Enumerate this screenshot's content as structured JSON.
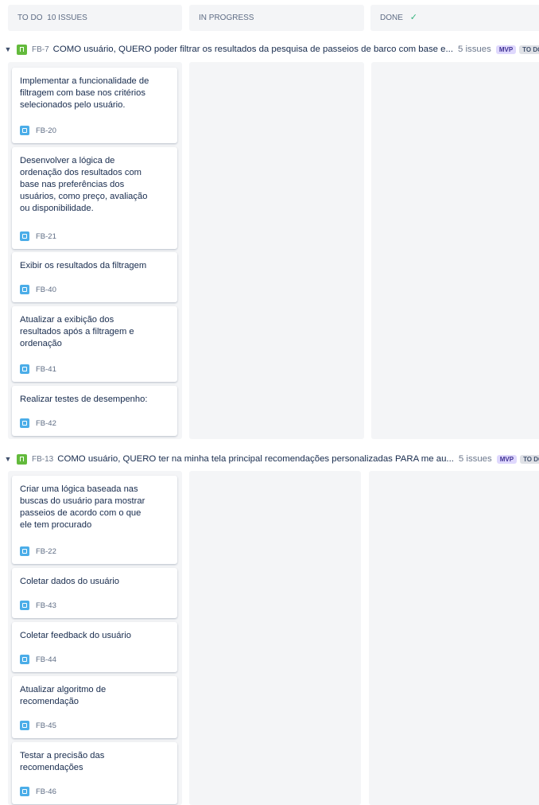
{
  "columns": [
    {
      "label": "TO DO",
      "count": "10 ISSUES"
    },
    {
      "label": "IN PROGRESS"
    },
    {
      "label": "DONE"
    }
  ],
  "swimlanes": [
    {
      "key": "FB-7",
      "summary": "COMO usuário, QUERO poder filtrar os resultados da pesquisa de passeios de barco com base e...",
      "issues": "5 issues",
      "label": "MVP",
      "status": "TO DO",
      "cards": [
        {
          "title": "Implementar a funcionalidade de filtragem com base nos critérios selecionados pelo usuário.",
          "key": "FB-20"
        },
        {
          "title": "Desenvolver a lógica de ordenação dos resultados com base nas preferências dos usuários, como preço, avaliação ou disponibilidade.",
          "key": "FB-21"
        },
        {
          "title": "Exibir os resultados da filtragem",
          "key": "FB-40"
        },
        {
          "title": "Atualizar a exibição dos resultados após a filtragem e ordenação",
          "key": "FB-41"
        },
        {
          "title": "Realizar testes de desempenho:",
          "key": "FB-42"
        }
      ]
    },
    {
      "key": "FB-13",
      "summary": "COMO usuário, QUERO ter na minha tela principal recomendações personalizadas PARA me au...",
      "issues": "5 issues",
      "label": "MVP",
      "status": "TO DO",
      "cards": [
        {
          "title": "Criar uma lógica baseada nas buscas do usuário para mostrar passeios de acordo com o que ele tem procurado",
          "key": "FB-22"
        },
        {
          "title": "Coletar dados do usuário",
          "key": "FB-43"
        },
        {
          "title": "Coletar feedback do usuário",
          "key": "FB-44"
        },
        {
          "title": "Atualizar algoritmo de recomendação",
          "key": "FB-45"
        },
        {
          "title": "Testar a precisão das recomendações",
          "key": "FB-46"
        }
      ]
    }
  ],
  "icons": {
    "swimlane": "story-icon",
    "card": "task-icon",
    "done": "check-icon",
    "toggle": "chevron-down-icon"
  },
  "colors": {
    "story": "#63ba3c",
    "task": "#4bade8",
    "done_check": "#36b37e",
    "column_bg": "#f4f5f7",
    "mvp_label_bg": "#dfd8fd"
  }
}
